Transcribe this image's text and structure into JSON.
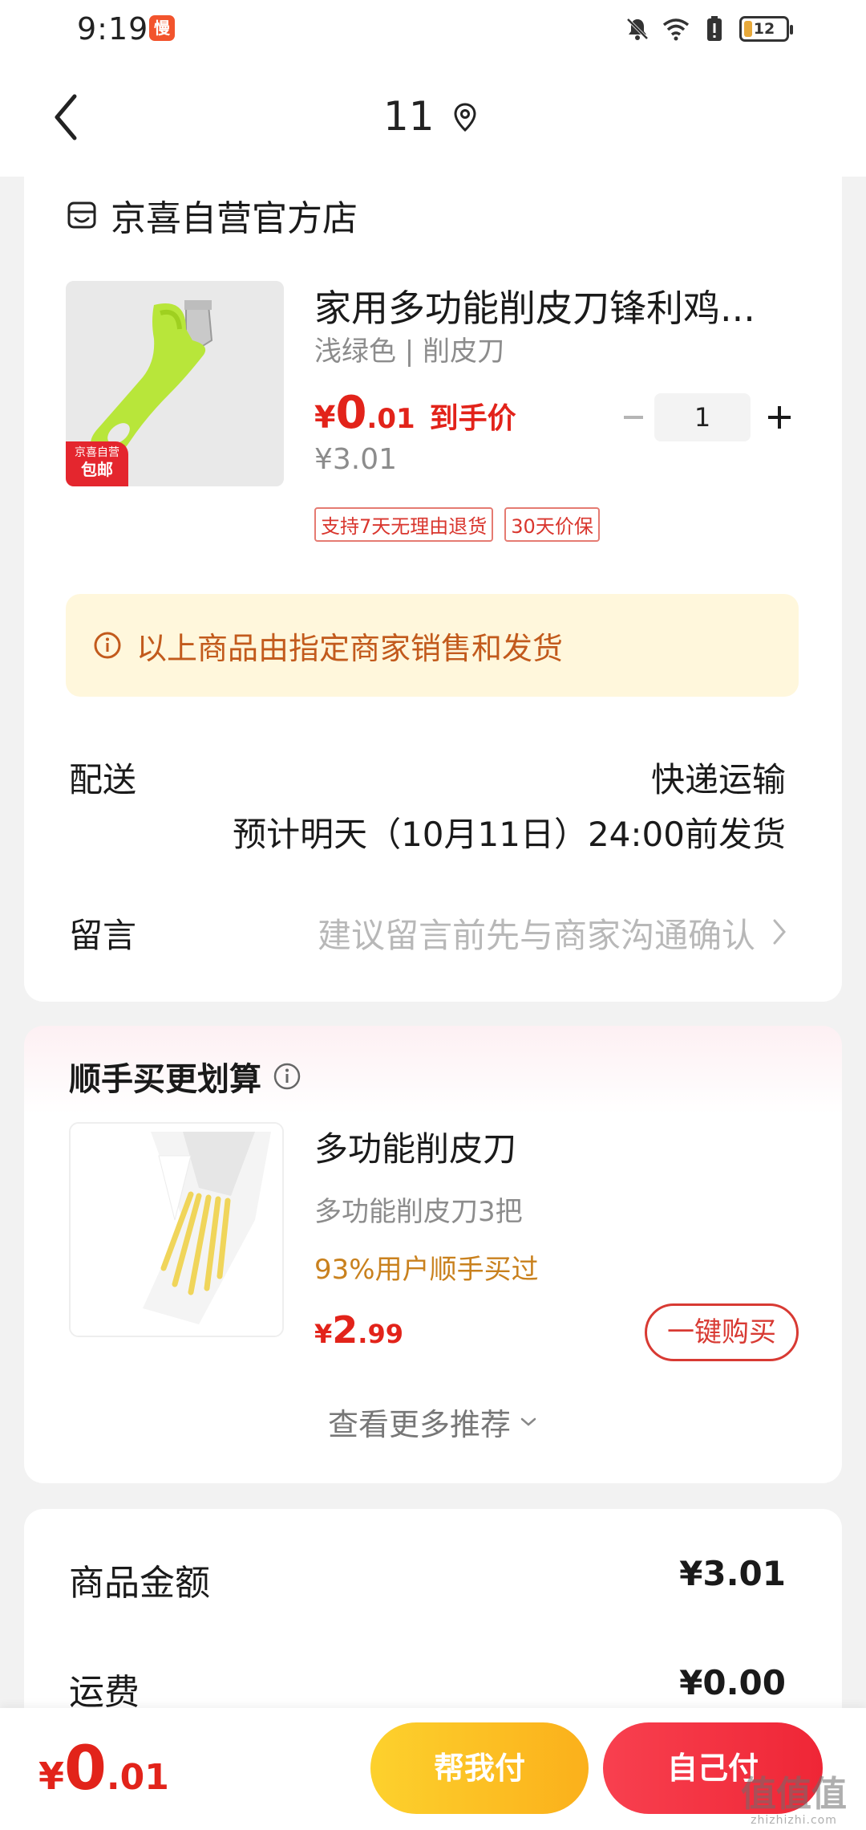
{
  "status_bar": {
    "time": "9:19",
    "app_badge": "慢",
    "battery": "12",
    "icons": [
      "bell-off-icon",
      "wifi-icon",
      "battery-alert-icon",
      "battery-icon"
    ]
  },
  "nav": {
    "title": "11",
    "back_icon": "chevron-left-icon",
    "location_icon": "location-pin-icon"
  },
  "order": {
    "shop_name": "京喜自营官方店",
    "product": {
      "title": "家用多功能削皮刀锋利鸡...",
      "spec": "浅绿色 | 削皮刀",
      "price_symbol": "¥",
      "price_int": "0",
      "price_dec": ".01",
      "price_tag": "到手价",
      "original_price": "¥3.01",
      "quantity": "1",
      "badge_line1": "京喜自营",
      "badge_line2": "包邮",
      "tags": [
        "支持7天无理由退货",
        "30天价保"
      ]
    },
    "notice": "以上商品由指定商家销售和发货",
    "delivery": {
      "label": "配送",
      "method": "快递运输",
      "eta": "预计明天（10月11日）24:00前发货"
    },
    "message": {
      "label": "留言",
      "placeholder": "建议留言前先与商家沟通确认"
    }
  },
  "recommend": {
    "title": "顺手买更划算",
    "item": {
      "name": "多功能削皮刀",
      "desc": "多功能削皮刀3把",
      "social": "93%用户顺手买过",
      "price_symbol": "¥",
      "price_int": "2",
      "price_dec": ".99",
      "buy_label": "一键购买"
    },
    "more": "查看更多推荐"
  },
  "summary": {
    "rows": [
      {
        "label": "商品金额",
        "value": "¥3.01"
      },
      {
        "label": "运费",
        "value": "¥0.00"
      }
    ]
  },
  "bottom": {
    "price_symbol": "¥",
    "price_int": "0",
    "price_dec": ".01",
    "help_pay": "帮我付",
    "self_pay": "自己付"
  },
  "watermark": {
    "line1": "值值值",
    "line2": "zhizhizhi.com"
  },
  "colors": {
    "accent_red": "#e2231a",
    "notice_bg": "#fff7dc",
    "notice_text": "#c25a1c",
    "help_pay_yellow": "#fcc424",
    "self_pay_red": "#f2303f"
  }
}
